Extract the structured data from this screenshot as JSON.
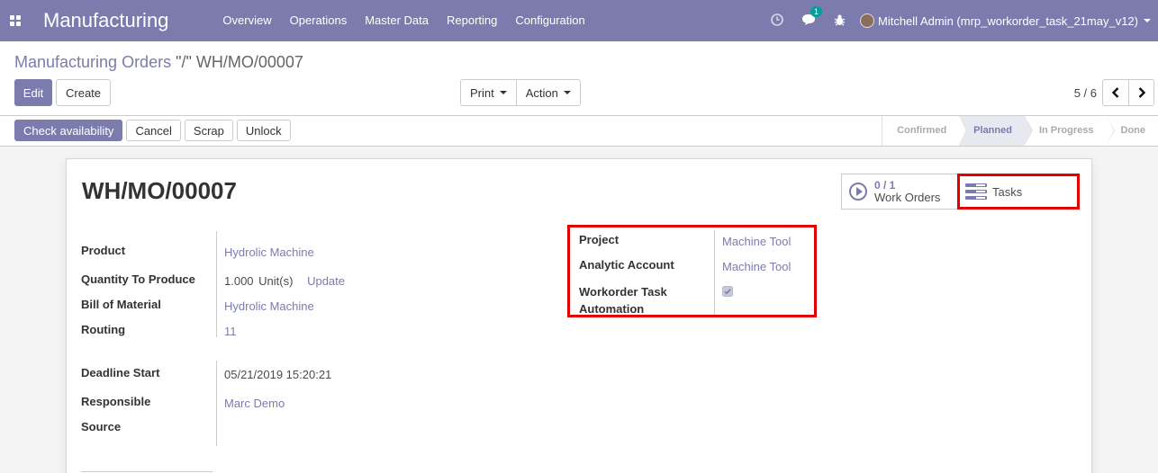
{
  "navbar": {
    "brand": "Manufacturing",
    "menu": [
      "Overview",
      "Operations",
      "Master Data",
      "Reporting",
      "Configuration"
    ],
    "chat_badge": "1",
    "user": "Mitchell Admin (mrp_workorder_task_21may_v12)"
  },
  "control_panel": {
    "breadcrumb_parent": "Manufacturing Orders",
    "breadcrumb_sep": "\"/\"",
    "breadcrumb_current": "WH/MO/00007",
    "edit": "Edit",
    "create": "Create",
    "print": "Print",
    "action": "Action",
    "pager": "5 / 6"
  },
  "statusbar": {
    "buttons": [
      "Check availability",
      "Cancel",
      "Scrap",
      "Unlock"
    ],
    "stages": [
      "Confirmed",
      "Planned",
      "In Progress",
      "Done"
    ],
    "active_stage": "Planned"
  },
  "form": {
    "title": "WH/MO/00007",
    "smart_buttons": {
      "workorders_count": "0 / 1",
      "workorders_label": "Work Orders",
      "tasks_label": "Tasks"
    },
    "left": {
      "product_label": "Product",
      "product_value": "Hydrolic Machine",
      "qty_label": "Quantity To Produce",
      "qty_value": "1.000",
      "qty_uom": "Unit(s)",
      "qty_update": "Update",
      "bom_label": "Bill of Material",
      "bom_value": "Hydrolic Machine",
      "routing_label": "Routing",
      "routing_value": "11",
      "deadline_label": "Deadline Start",
      "deadline_value": "05/21/2019 15:20:21",
      "responsible_label": "Responsible",
      "responsible_value": "Marc Demo",
      "source_label": "Source"
    },
    "right": {
      "project_label": "Project",
      "project_value": "Machine Tool",
      "analytic_label": "Analytic Account",
      "analytic_value": "Machine Tool",
      "automation_label_1": "Workorder Task",
      "automation_label_2": "Automation",
      "automation_checked": true
    }
  },
  "colors": {
    "brand": "#7c7bad",
    "highlight": "#e00000"
  }
}
